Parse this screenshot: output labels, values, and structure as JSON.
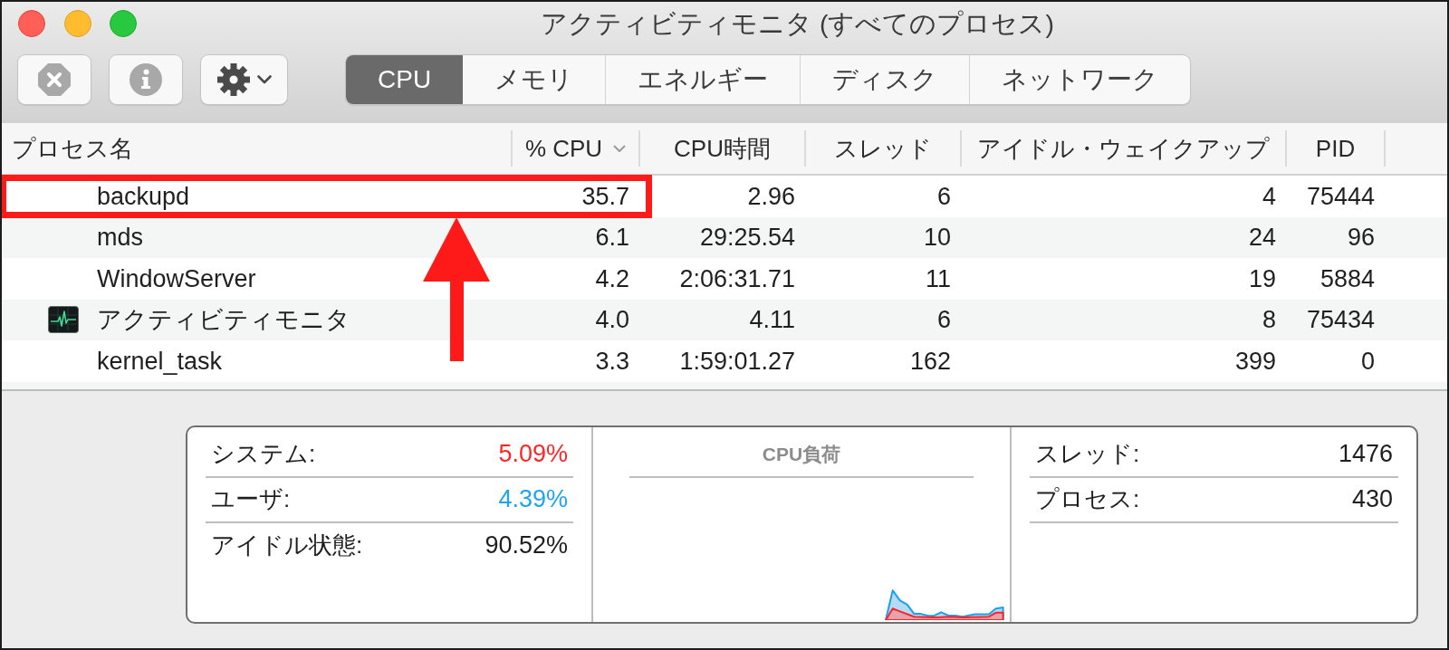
{
  "window": {
    "title": "アクティビティモニタ (すべてのプロセス)"
  },
  "tabs": [
    {
      "label": "CPU",
      "selected": true
    },
    {
      "label": "メモリ",
      "selected": false
    },
    {
      "label": "エネルギー",
      "selected": false
    },
    {
      "label": "ディスク",
      "selected": false
    },
    {
      "label": "ネットワーク",
      "selected": false
    }
  ],
  "table": {
    "columns": [
      {
        "label": "プロセス名",
        "sorted": false
      },
      {
        "label": "% CPU",
        "sorted": true
      },
      {
        "label": "CPU時間",
        "sorted": false
      },
      {
        "label": "スレッド",
        "sorted": false
      },
      {
        "label": "アイドル・ウェイクアップ",
        "sorted": false
      },
      {
        "label": "PID",
        "sorted": false
      }
    ],
    "rows": [
      {
        "cells": [
          "backupd",
          "35.7",
          "2.96",
          "6",
          "4",
          "75444"
        ],
        "has_icon": false,
        "highlighted": true
      },
      {
        "cells": [
          "mds",
          "6.1",
          "29:25.54",
          "10",
          "24",
          "96"
        ],
        "has_icon": false,
        "highlighted": false
      },
      {
        "cells": [
          "WindowServer",
          "4.2",
          "2:06:31.71",
          "11",
          "19",
          "5884"
        ],
        "has_icon": false,
        "highlighted": false
      },
      {
        "cells": [
          "アクティビティモニタ",
          "4.0",
          "4.11",
          "6",
          "8",
          "75434"
        ],
        "has_icon": true,
        "highlighted": false
      },
      {
        "cells": [
          "kernel_task",
          "3.3",
          "1:59:01.27",
          "162",
          "399",
          "0"
        ],
        "has_icon": false,
        "highlighted": false
      }
    ]
  },
  "summary": {
    "cpu": [
      {
        "label": "システム:",
        "value": "5.09%",
        "color": "#ff2525"
      },
      {
        "label": "ユーザ:",
        "value": "4.39%",
        "color": "#1ea4f2"
      },
      {
        "label": "アイドル状態:",
        "value": "90.52%",
        "color": "#1e1e1e"
      }
    ],
    "chart": {
      "title": "CPU負荷"
    },
    "counts": [
      {
        "label": "スレッド:",
        "value": "1476"
      },
      {
        "label": "プロセス:",
        "value": "430"
      }
    ]
  }
}
